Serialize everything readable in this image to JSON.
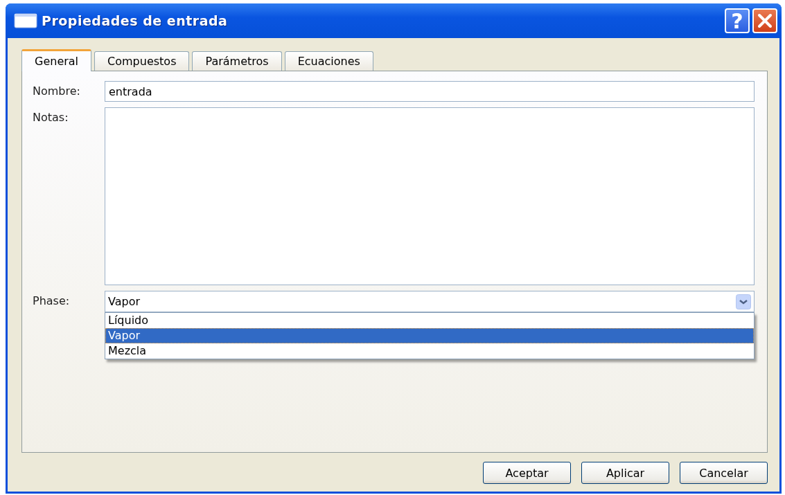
{
  "window": {
    "title": "Propiedades de entrada",
    "help_button": "?"
  },
  "tabs": [
    {
      "label": "General",
      "selected": true
    },
    {
      "label": "Compuestos",
      "selected": false
    },
    {
      "label": "Parámetros",
      "selected": false
    },
    {
      "label": "Ecuaciones",
      "selected": false
    }
  ],
  "fields": {
    "name": {
      "label": "Nombre:",
      "value": "entrada"
    },
    "notes": {
      "label": "Notas:"
    },
    "phase": {
      "label": "Phase:",
      "value": "Vapor",
      "expanded": true,
      "options": [
        {
          "label": "Líquido",
          "selected": false
        },
        {
          "label": "Vapor",
          "selected": true
        },
        {
          "label": "Mezcla",
          "selected": false
        }
      ]
    }
  },
  "buttons": [
    "Aceptar",
    "Aplicar",
    "Cancelar"
  ]
}
